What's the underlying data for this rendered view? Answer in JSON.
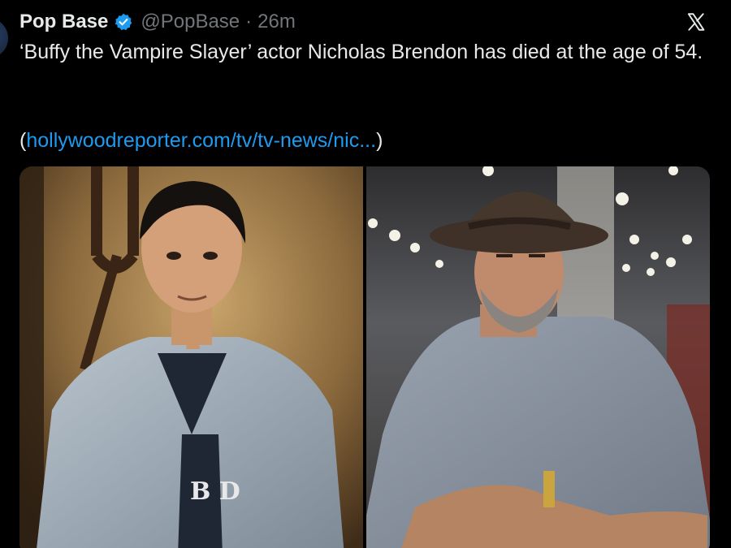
{
  "tweet": {
    "author_name": "Pop Base",
    "handle": "@PopBase",
    "separator": "·",
    "time": "26m",
    "text": "‘Buffy the Vampire Slayer’ actor Nicholas Brendon has died at the age of 54.",
    "link_open": "(",
    "link_text": "hollywoodreporter.com/tv/tv-news/nic...",
    "link_close": ")",
    "verified_icon": "verified-badge-icon",
    "close_icon": "x-close-icon"
  },
  "media": {
    "photos": [
      {
        "name": "photo-left",
        "shirt_text": "B D"
      },
      {
        "name": "photo-right"
      }
    ]
  },
  "colors": {
    "background": "#000000",
    "text": "#e7e9ea",
    "secondary": "#71767b",
    "link": "#1d9bf0",
    "verified": "#1d9bf0"
  }
}
